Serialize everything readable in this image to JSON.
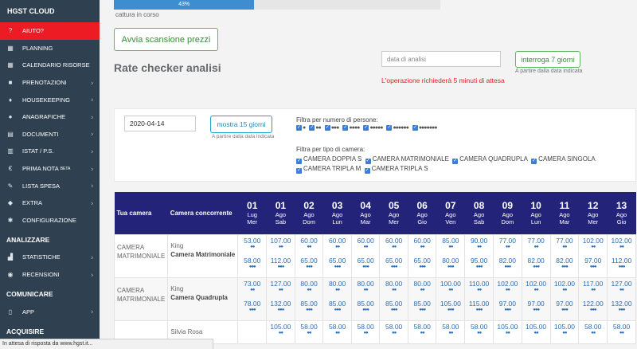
{
  "brand": "HGST CLOUD",
  "sidebar": {
    "items": [
      {
        "icon": "?",
        "name": "help-icon",
        "label": "AIUTO?",
        "chevron": false,
        "active": true
      },
      {
        "icon": "▦",
        "name": "calendar-icon",
        "label": "PLANNING",
        "chevron": false
      },
      {
        "icon": "▦",
        "name": "calendar-icon",
        "label": "CALENDARIO RISORSE",
        "chevron": false
      },
      {
        "icon": "■",
        "name": "folder-icon",
        "label": "PRENOTAZIONI",
        "chevron": true
      },
      {
        "icon": "♦",
        "name": "housekeeping-icon",
        "label": "HOUSEKEEPING",
        "chevron": true
      },
      {
        "icon": "●",
        "name": "user-icon",
        "label": "ANAGRAFICHE",
        "chevron": true
      },
      {
        "icon": "▤",
        "name": "document-icon",
        "label": "DOCUMENTI",
        "chevron": true
      },
      {
        "icon": "▥",
        "name": "istat-icon",
        "label": "ISTAT / P.S.",
        "chevron": true
      },
      {
        "icon": "€",
        "name": "euro-icon",
        "label": "PRIMA NOTA",
        "sup": "BETA",
        "chevron": true
      },
      {
        "icon": "✎",
        "name": "list-icon",
        "label": "LISTA SPESA",
        "chevron": true
      },
      {
        "icon": "◆",
        "name": "extra-icon",
        "label": "EXTRA",
        "chevron": true
      },
      {
        "icon": "✱",
        "name": "gear-icon",
        "label": "CONFIGURAZIONE",
        "chevron": false
      }
    ],
    "sec_analyze": "ANALIZZARE",
    "analyze_items": [
      {
        "icon": "▟",
        "name": "stats-icon",
        "label": "STATISTICHE",
        "chevron": true
      },
      {
        "icon": "◉",
        "name": "reviews-icon",
        "label": "RECENSIONI",
        "chevron": true
      }
    ],
    "sec_comm": "COMUNICARE",
    "comm_items": [
      {
        "icon": "▯",
        "name": "mobile-icon",
        "label": "APP",
        "chevron": true
      }
    ],
    "sec_acq": "ACQUISIRE"
  },
  "progress": {
    "value": 43,
    "label": "43%",
    "caption": "cattura in corso"
  },
  "scan_button": "Avvia scansione prezzi",
  "page_title": "Rate checker analisi",
  "analysis": {
    "date_placeholder": "data di analisi",
    "query7": "interroga 7 giorni",
    "hint": "A partire dalla data indicata",
    "warning": "L'operazione richiederà 5 minuti di attesa"
  },
  "filters": {
    "date_value": "2020-04-14",
    "show15": "mostra 15 giorni",
    "hint": "A partire dalla data indicata",
    "persons_label": "Filtra per numero di persone:",
    "person_counts": [
      1,
      2,
      3,
      4,
      5,
      6,
      7
    ],
    "room_label": "Filtra per tipo di camera:",
    "rooms": [
      "CAMERA DOPPIA S",
      "CAMERA MATRIMONIALE",
      "CAMERA QUADRUPLA",
      "CAMERA SINGOLA",
      "CAMERA TRIPLA M",
      "CAMERA TRIPLA S"
    ]
  },
  "table": {
    "col_room": "Tua camera",
    "col_comp": "Camera concorrente",
    "days": [
      {
        "d": "01",
        "m": "Lug",
        "w": "Mer"
      },
      {
        "d": "01",
        "m": "Ago",
        "w": "Sab"
      },
      {
        "d": "02",
        "m": "Ago",
        "w": "Dom"
      },
      {
        "d": "03",
        "m": "Ago",
        "w": "Lun"
      },
      {
        "d": "04",
        "m": "Ago",
        "w": "Mar"
      },
      {
        "d": "05",
        "m": "Ago",
        "w": "Mer"
      },
      {
        "d": "06",
        "m": "Ago",
        "w": "Gio"
      },
      {
        "d": "07",
        "m": "Ago",
        "w": "Ven"
      },
      {
        "d": "08",
        "m": "Ago",
        "w": "Sab"
      },
      {
        "d": "09",
        "m": "Ago",
        "w": "Dom"
      },
      {
        "d": "10",
        "m": "Ago",
        "w": "Lun"
      },
      {
        "d": "11",
        "m": "Ago",
        "w": "Mar"
      },
      {
        "d": "12",
        "m": "Ago",
        "w": "Mer"
      },
      {
        "d": "13",
        "m": "Ago",
        "w": "Gio"
      }
    ],
    "rows": [
      {
        "room": "CAMERA MATRIMONIALE",
        "comp_top": "King",
        "comp_name": "Camera Matrimoniale",
        "p1": [
          "53.00",
          "107.00",
          "60.00",
          "60.00",
          "60.00",
          "60.00",
          "60.00",
          "85.00",
          "90.00",
          "77.00",
          "77.00",
          "77.00",
          "102.00",
          "102.00"
        ],
        "p2": [
          "58.00",
          "112.00",
          "65.00",
          "65.00",
          "65.00",
          "65.00",
          "65.00",
          "80.00",
          "95.00",
          "82.00",
          "82.00",
          "82.00",
          "97.00",
          "112.00"
        ]
      },
      {
        "room": "CAMERA MATRIMONIALE",
        "comp_top": "King",
        "comp_name": "Camera Quadrupla",
        "p1": [
          "73.00",
          "127.00",
          "80.00",
          "80.00",
          "80.00",
          "80.00",
          "80.00",
          "100.00",
          "110.00",
          "102.00",
          "102.00",
          "102.00",
          "117.00",
          "127.00"
        ],
        "p2": [
          "78.00",
          "132.00",
          "85.00",
          "85.00",
          "85.00",
          "85.00",
          "85.00",
          "105.00",
          "115.00",
          "97.00",
          "97.00",
          "97.00",
          "122.00",
          "132.00"
        ]
      },
      {
        "room": "",
        "comp_top": "Silvia Rosa",
        "comp_name": "",
        "p1": [
          "",
          "105.00",
          "58.00",
          "58.00",
          "58.00",
          "58.00",
          "58.00",
          "58.00",
          "58.00",
          "105.00",
          "105.00",
          "105.00",
          "58.00",
          "58.00"
        ],
        "p2": []
      }
    ]
  },
  "statusbar": "In attesa di risposta da www.hgst.it..."
}
